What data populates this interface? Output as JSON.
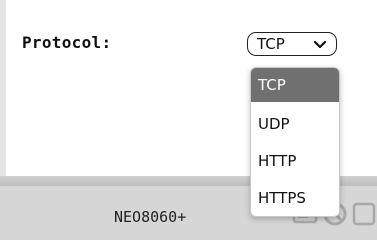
{
  "form": {
    "protocol_label": "Protocol:",
    "protocol_value": "TCP"
  },
  "dropdown": {
    "options": [
      "TCP",
      "UDP",
      "HTTP",
      "HTTPS"
    ],
    "selected": "TCP"
  },
  "footer": {
    "model": "NEO8060+",
    "icons": [
      "device-icon",
      "no-icon"
    ]
  },
  "colors": {
    "selected_option_bg": "#707070",
    "footer_bg": "#d6d6d6"
  }
}
